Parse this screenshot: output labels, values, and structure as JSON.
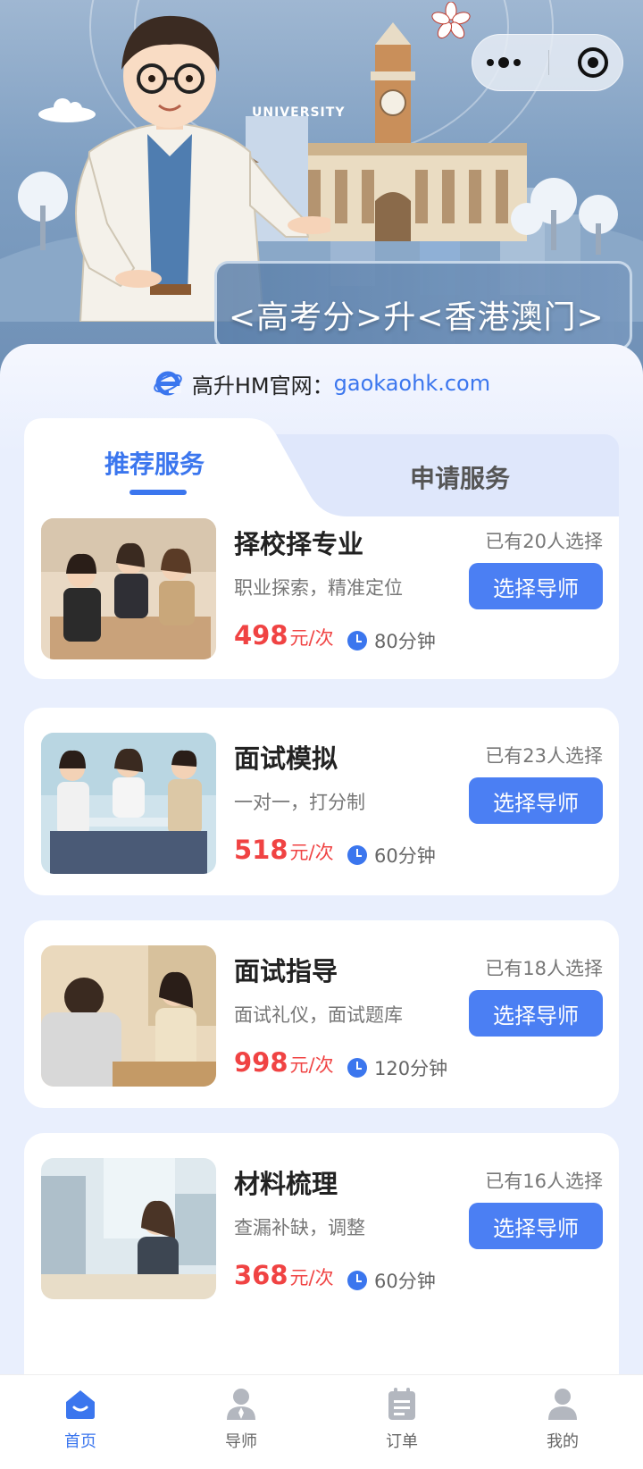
{
  "hero": {
    "title": "<高考分>升<香港澳门>",
    "sign_text": "UNIVERSITY"
  },
  "site": {
    "label": "高升HM官网：",
    "url": "gaokaohk.com"
  },
  "tabs": [
    {
      "label": "推荐服务",
      "active": true
    },
    {
      "label": "申请服务",
      "active": false
    }
  ],
  "services": [
    {
      "title": "择校择专业",
      "desc": "职业探索，精准定位",
      "count": "已有20人选择",
      "price": "498",
      "unit": "元/次",
      "duration": "80分钟",
      "button": "选择导师"
    },
    {
      "title": "面试模拟",
      "desc": "一对一，打分制",
      "count": "已有23人选择",
      "price": "518",
      "unit": "元/次",
      "duration": "60分钟",
      "button": "选择导师"
    },
    {
      "title": "面试指导",
      "desc": "面试礼仪，面试题库",
      "count": "已有18人选择",
      "price": "998",
      "unit": "元/次",
      "duration": "120分钟",
      "button": "选择导师"
    },
    {
      "title": "材料梳理",
      "desc": "查漏补缺，调整",
      "count": "已有16人选择",
      "price": "368",
      "unit": "元/次",
      "duration": "60分钟",
      "button": "选择导师"
    }
  ],
  "nav": [
    {
      "label": "首页",
      "icon": "home-icon",
      "active": true
    },
    {
      "label": "导师",
      "icon": "mentor-icon",
      "active": false
    },
    {
      "label": "订单",
      "icon": "order-icon",
      "active": false
    },
    {
      "label": "我的",
      "icon": "profile-icon",
      "active": false
    }
  ],
  "colors": {
    "accent": "#3b76ee",
    "price": "#f04343",
    "button": "#4b7ff3"
  }
}
